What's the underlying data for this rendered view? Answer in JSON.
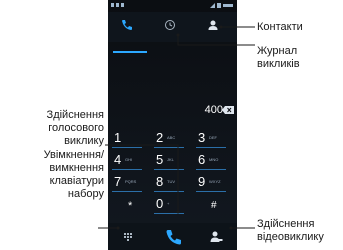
{
  "phone": {
    "number": "400"
  },
  "keypad": [
    {
      "digit": "1",
      "letters": ""
    },
    {
      "digit": "2",
      "letters": "ABC"
    },
    {
      "digit": "3",
      "letters": "DEF"
    },
    {
      "digit": "4",
      "letters": "GHI"
    },
    {
      "digit": "5",
      "letters": "JKL"
    },
    {
      "digit": "6",
      "letters": "MNO"
    },
    {
      "digit": "7",
      "letters": "PQRS"
    },
    {
      "digit": "8",
      "letters": "TUV"
    },
    {
      "digit": "9",
      "letters": "WXYZ"
    },
    {
      "digit": "*",
      "letters": ""
    },
    {
      "digit": "0",
      "letters": "+"
    },
    {
      "digit": "#",
      "letters": ""
    }
  ],
  "icons": {
    "tab1": "phone-icon",
    "tab2": "clock-icon",
    "tab3": "contact-icon",
    "backspace": "backspace-icon",
    "dialpad": "dialpad-icon",
    "call": "call-icon",
    "video": "video-call-icon"
  },
  "colors": {
    "accent": "#2ca8ff"
  },
  "callouts": {
    "contacts": "Контакти",
    "call_log_line1": "Журнал",
    "call_log_line2": "викликів",
    "voice_call_line1": "Здійснення",
    "voice_call_line2": "голосового",
    "voice_call_line3": "виклику",
    "keypad_toggle_line1": "Увімкнення/",
    "keypad_toggle_line2": "вимкнення",
    "keypad_toggle_line3": "клавіатури",
    "keypad_toggle_line4": "набору",
    "video_call_line1": "Здійснення",
    "video_call_line2": "відеовиклику"
  }
}
